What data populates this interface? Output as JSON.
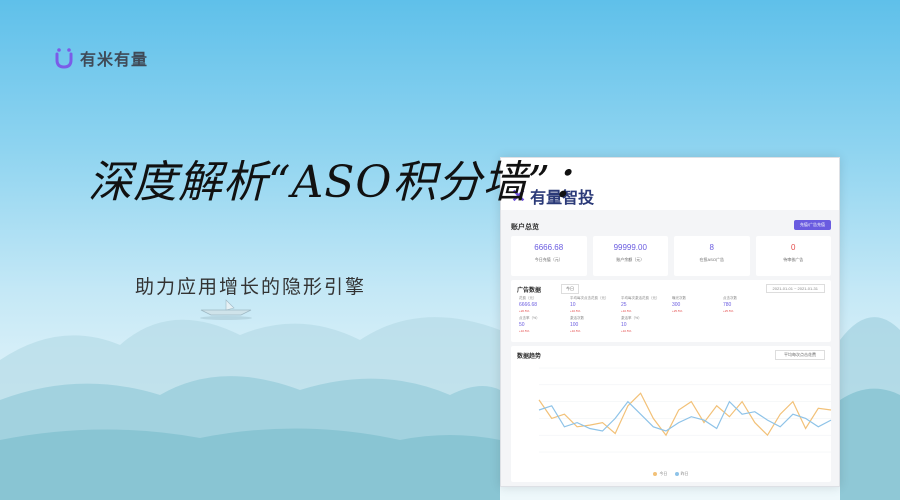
{
  "brand": {
    "name": "有米有量",
    "color": "#7b5ce8"
  },
  "headline": "深度解析“ASO积分墙”：",
  "subtitle": "助力应用增长的隐形引擎",
  "dashboard": {
    "logo": "有量智投",
    "account_title": "账户总览",
    "action_button": "充值/广告充值",
    "cards": [
      {
        "value": "6666.68",
        "label": "今日充值（元）",
        "color": "#6a5ce0"
      },
      {
        "value": "99999.00",
        "label": "账户余额（元）",
        "color": "#6a5ce0"
      },
      {
        "value": "8",
        "label": "在投ASO广告",
        "color": "#6a5ce0"
      },
      {
        "value": "0",
        "label": "待审核广告",
        "color": "#e34a4a"
      }
    ],
    "ad_panel": {
      "title": "广告数据",
      "tab": "今日",
      "date_range": "2021-01-01 ~ 2021-01-31",
      "metrics": [
        {
          "key": "花费（元）",
          "value": "6666.68",
          "trend": "+20.5%"
        },
        {
          "key": "平均每次点击花费（元）",
          "value": "10",
          "trend": "+10.5%"
        },
        {
          "key": "平均每次激活花费（元）",
          "value": "25",
          "trend": "+10.5%"
        },
        {
          "key": "曝光次数",
          "value": "300",
          "trend": "+25.5%"
        },
        {
          "key": "点击次数",
          "value": "780",
          "trend": "+25.5%"
        },
        {
          "key": "",
          "value": "",
          "trend": ""
        },
        {
          "key": "点击率（%）",
          "value": "50",
          "trend": "+10.5%"
        },
        {
          "key": "激活次数",
          "value": "100",
          "trend": "+10.5%"
        },
        {
          "key": "激活率（%）",
          "value": "10",
          "trend": "+10.5%"
        }
      ]
    },
    "trend_panel": {
      "title": "数据趋势",
      "selector": "平均每次点击花费",
      "legend": [
        "今日",
        "昨日"
      ]
    }
  },
  "chart_data": {
    "type": "line",
    "x_count": 24,
    "ylim": [
      0,
      100
    ],
    "series": [
      {
        "name": "今日",
        "color": "#f2c178",
        "values": [
          62,
          40,
          45,
          30,
          32,
          35,
          22,
          55,
          70,
          40,
          20,
          50,
          60,
          35,
          55,
          42,
          60,
          35,
          20,
          45,
          60,
          28,
          52,
          50
        ]
      },
      {
        "name": "昨日",
        "color": "#8ec3e8",
        "values": [
          50,
          55,
          30,
          35,
          28,
          25,
          40,
          60,
          45,
          30,
          25,
          35,
          42,
          38,
          28,
          60,
          45,
          48,
          38,
          30,
          45,
          40,
          30,
          38
        ]
      }
    ]
  }
}
